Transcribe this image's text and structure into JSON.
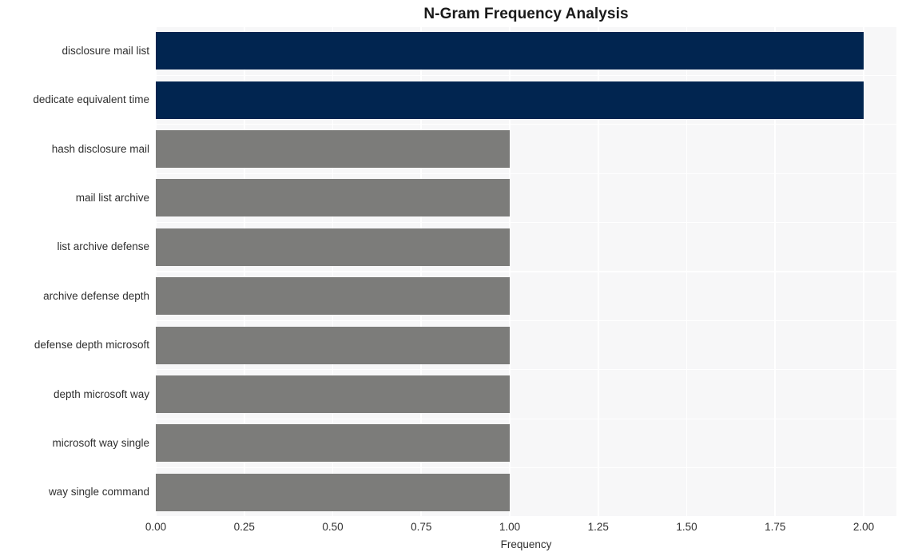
{
  "chart_data": {
    "type": "bar",
    "orientation": "horizontal",
    "title": "N-Gram Frequency Analysis",
    "xlabel": "Frequency",
    "ylabel": "",
    "xlim": [
      0.0,
      2.0
    ],
    "xticks": [
      "0.00",
      "0.25",
      "0.50",
      "0.75",
      "1.00",
      "1.25",
      "1.50",
      "1.75",
      "2.00"
    ],
    "xtick_values": [
      0.0,
      0.25,
      0.5,
      0.75,
      1.0,
      1.25,
      1.5,
      1.75,
      2.0
    ],
    "grid": true,
    "legend": "none",
    "plot_bgcolor": "#f7f7f8",
    "gridline_color": "#ffffff",
    "categories": [
      "disclosure mail list",
      "dedicate equivalent time",
      "hash disclosure mail",
      "mail list archive",
      "list archive defense",
      "archive defense depth",
      "defense depth microsoft",
      "depth microsoft way",
      "microsoft way single",
      "way single command"
    ],
    "values": [
      2,
      2,
      1,
      1,
      1,
      1,
      1,
      1,
      1,
      1
    ],
    "bar_colors": [
      "#012550",
      "#012550",
      "#7c7c7a",
      "#7c7c7a",
      "#7c7c7a",
      "#7c7c7a",
      "#7c7c7a",
      "#7c7c7a",
      "#7c7c7a",
      "#7c7c7a"
    ],
    "colors": {
      "highlight": "#012550",
      "default": "#7c7c7a",
      "background": "#ffffff",
      "text": "#2f2f2f",
      "title": "#1a1a1a"
    }
  }
}
